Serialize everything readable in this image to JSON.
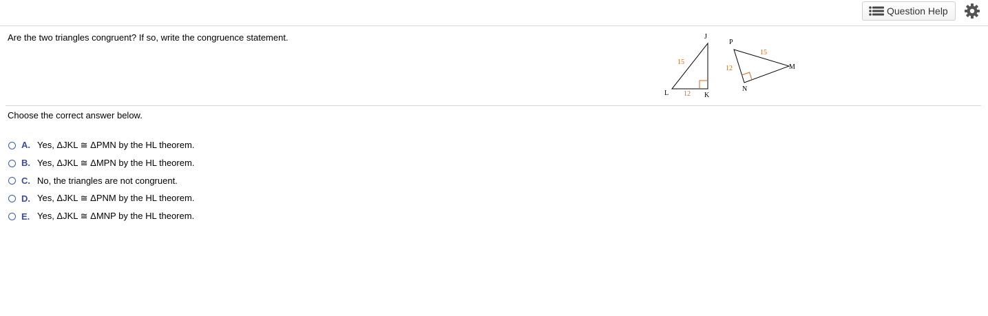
{
  "toolbar": {
    "help_label": "Question Help"
  },
  "question": {
    "text": "Are the two triangles congruent? If so, write the congruence statement."
  },
  "figure": {
    "triangle1": {
      "vertex_labels": [
        "J",
        "K",
        "L"
      ],
      "hypotenuse_label": "15",
      "leg_label": "12"
    },
    "triangle2": {
      "vertex_labels": [
        "P",
        "N",
        "M"
      ],
      "hypotenuse_label": "15",
      "leg_label": "12"
    },
    "label_color": "#d2691e",
    "line_color": "#000000"
  },
  "prompt": "Choose the correct answer below.",
  "answers": [
    {
      "letter": "A.",
      "text": "Yes, ΔJKL ≅ ΔPMN by the HL theorem."
    },
    {
      "letter": "B.",
      "text": "Yes, ΔJKL ≅ ΔMPN by the HL theorem."
    },
    {
      "letter": "C.",
      "text": "No, the triangles are not congruent."
    },
    {
      "letter": "D.",
      "text": "Yes, ΔJKL ≅ ΔPNM by the HL theorem."
    },
    {
      "letter": "E.",
      "text": "Yes, ΔJKL ≅ ΔMNP by the HL theorem."
    }
  ],
  "colors": {
    "accent": "#3b4b9a",
    "divider": "#d6d6d6"
  },
  "icons": [
    "list-icon",
    "gear-icon",
    "radio-icon"
  ]
}
